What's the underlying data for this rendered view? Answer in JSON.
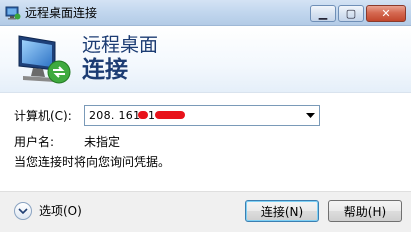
{
  "window": {
    "title": "远程桌面连接",
    "controls": {
      "minimize": "▁",
      "maximize": "▢",
      "close": "✕"
    }
  },
  "banner": {
    "line1": "远程桌面",
    "line2": "连接",
    "icon": "remote-desktop-monitor-icon"
  },
  "form": {
    "computer_label": "计算机(C):",
    "computer_value": "208. 161. 1  6.  ",
    "username_label": "用户名:",
    "username_value": "未指定",
    "hint": "当您连接时将向您询问凭据。"
  },
  "footer": {
    "options_label": "选项(O)",
    "connect_label": "连接(N)",
    "help_label": "帮助(H)"
  },
  "colors": {
    "banner_text": "#1c3c73",
    "titlebar": "#c1d6ee",
    "redaction": "#e8121a"
  }
}
